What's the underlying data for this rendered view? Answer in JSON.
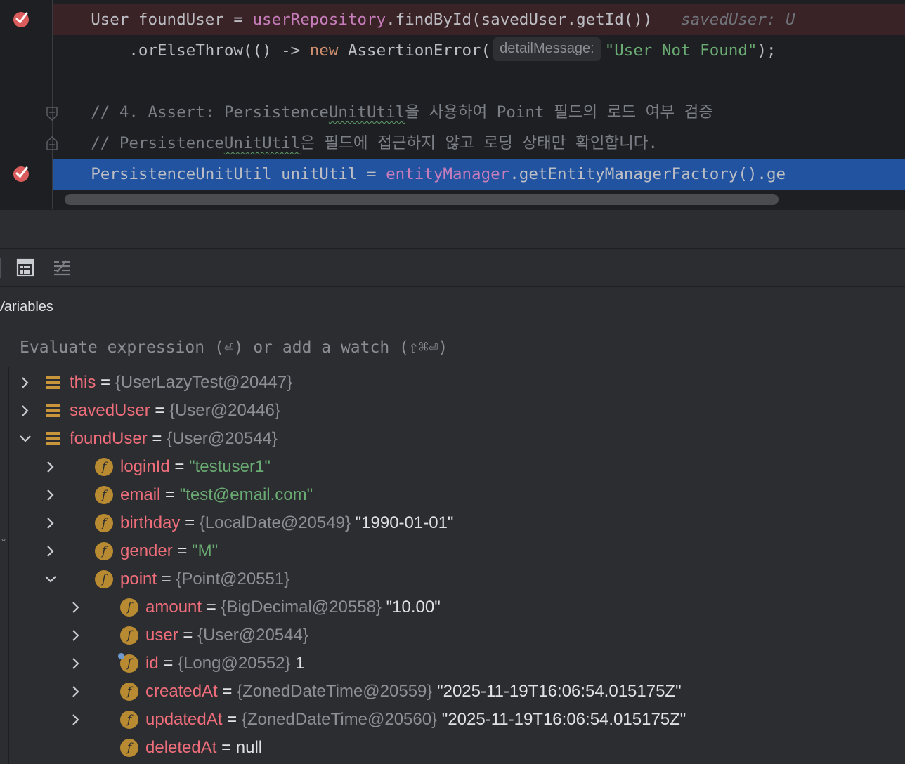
{
  "editor": {
    "lines": [
      {
        "code": "User foundUser = ",
        "field": "userRepository",
        "rest": ".findById(savedUser.getId())",
        "hint": "savedUser: U"
      },
      {
        "code": ".orElseThrow(() -> ",
        "kw": "new",
        "call": " AssertionError(",
        "param_hint": "detailMessage:",
        "str": "\"User Not Found\"",
        "tail": ");"
      },
      {
        "comment_a": "// 4. Assert: Persistence",
        "comment_b": "UnitUtil",
        "comment_c": "을 사용하여 Point 필드의 로드 여부 검증"
      },
      {
        "comment_a": "// Persistence",
        "comment_b": "UnitUtil",
        "comment_c": "은 필드에 접근하지 않고 로딩 상태만 확인합니다."
      },
      {
        "code": "PersistenceUnitUtil unitUtil = ",
        "field": "entityManager",
        "rest": ".getEntityManagerFactory().ge"
      }
    ]
  },
  "panel": {
    "title": "Variables",
    "eval_placeholder": "Evaluate expression (⏎) or add a watch (⇧⌘⏎)"
  },
  "icons": {
    "breakpoint": "breakpoint-check-icon",
    "fold": "fold-icon",
    "calculator": "calculator-icon",
    "collapse": "collapse-lines-icon",
    "chevron_right": "chevron-right-icon",
    "chevron_down": "chevron-down-icon",
    "object": "object-stack-icon",
    "field": "field-f-icon"
  },
  "variables": [
    {
      "name": "this",
      "ref": "{UserLazyTest@20447}",
      "value": "",
      "kind": "obj",
      "expanded": false
    },
    {
      "name": "savedUser",
      "ref": "{User@20446}",
      "value": "",
      "kind": "obj",
      "expanded": false
    },
    {
      "name": "foundUser",
      "ref": "{User@20544}",
      "value": "",
      "kind": "obj",
      "expanded": true
    },
    {
      "name": "loginId",
      "ref": "",
      "value": "\"testuser1\"",
      "kind": "field",
      "expanded": false
    },
    {
      "name": "email",
      "ref": "",
      "value": "\"test@email.com\"",
      "kind": "field",
      "expanded": false
    },
    {
      "name": "birthday",
      "ref": "{LocalDate@20549}",
      "value": "\"1990-01-01\"",
      "kind": "field",
      "expanded": false
    },
    {
      "name": "gender",
      "ref": "",
      "value": "\"M\"",
      "kind": "field",
      "expanded": false
    },
    {
      "name": "point",
      "ref": "{Point@20551}",
      "value": "",
      "kind": "field",
      "expanded": true
    },
    {
      "name": "amount",
      "ref": "{BigDecimal@20558}",
      "value": "\"10.00\"",
      "kind": "field",
      "expanded": false
    },
    {
      "name": "user",
      "ref": "{User@20544}",
      "value": "",
      "kind": "field",
      "expanded": false
    },
    {
      "name": "id",
      "ref": "{Long@20552}",
      "value": "1",
      "kind": "field",
      "expanded": false
    },
    {
      "name": "createdAt",
      "ref": "{ZonedDateTime@20559}",
      "value": "\"2025-11-19T16:06:54.015175Z\"",
      "kind": "field",
      "expanded": false
    },
    {
      "name": "updatedAt",
      "ref": "{ZonedDateTime@20560}",
      "value": "\"2025-11-19T16:06:54.015175Z\"",
      "kind": "field",
      "expanded": false
    },
    {
      "name": "deletedAt",
      "ref": "",
      "value": "null",
      "kind": "field",
      "expanded": false
    }
  ],
  "field_icon_letter": "f",
  "eq_sign": "="
}
